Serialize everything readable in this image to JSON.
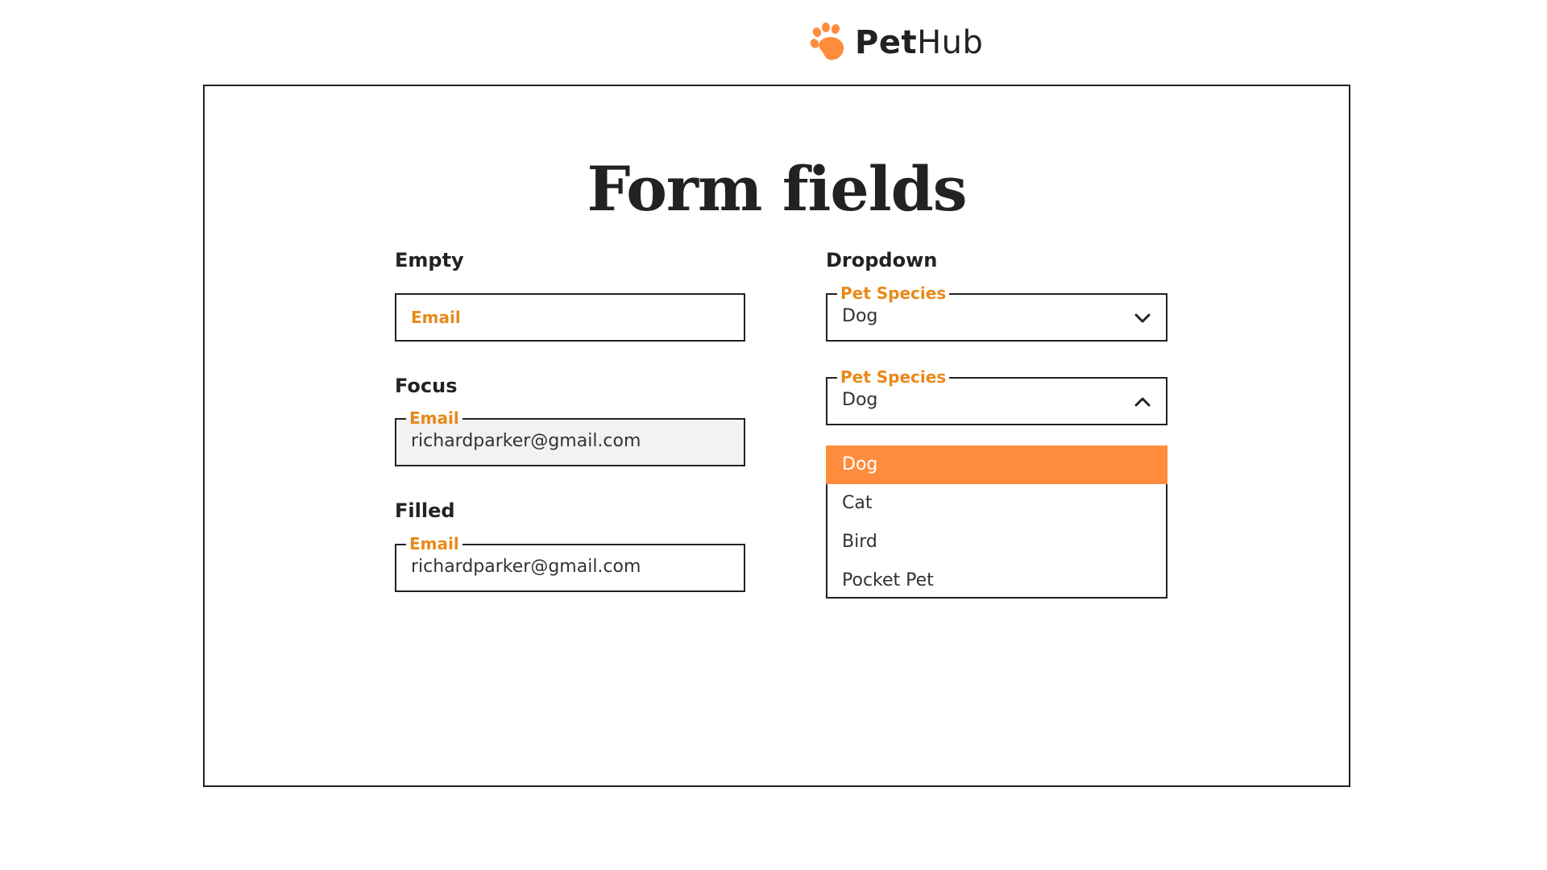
{
  "brand": {
    "name_bold": "Pet",
    "name_light": "Hub",
    "accent_color": "#ff8c3d",
    "label_color": "#e8891a"
  },
  "page": {
    "title": "Form fields"
  },
  "sections": {
    "empty": {
      "label": "Empty",
      "placeholder": "Email"
    },
    "focus": {
      "label": "Focus",
      "field_label": "Email",
      "value": "richardparker@gmail.com"
    },
    "filled": {
      "label": "Filled",
      "field_label": "Email",
      "value": "richardparker@gmail.com"
    },
    "dropdown": {
      "label": "Dropdown",
      "closed": {
        "field_label": "Pet Species",
        "value": "Dog",
        "icon": "chevron-down-icon"
      },
      "open": {
        "field_label": "Pet Species",
        "value": "Dog",
        "icon": "chevron-up-icon"
      },
      "options": [
        "Dog",
        "Cat",
        "Bird",
        "Pocket Pet"
      ],
      "selected_option": "Dog"
    }
  }
}
